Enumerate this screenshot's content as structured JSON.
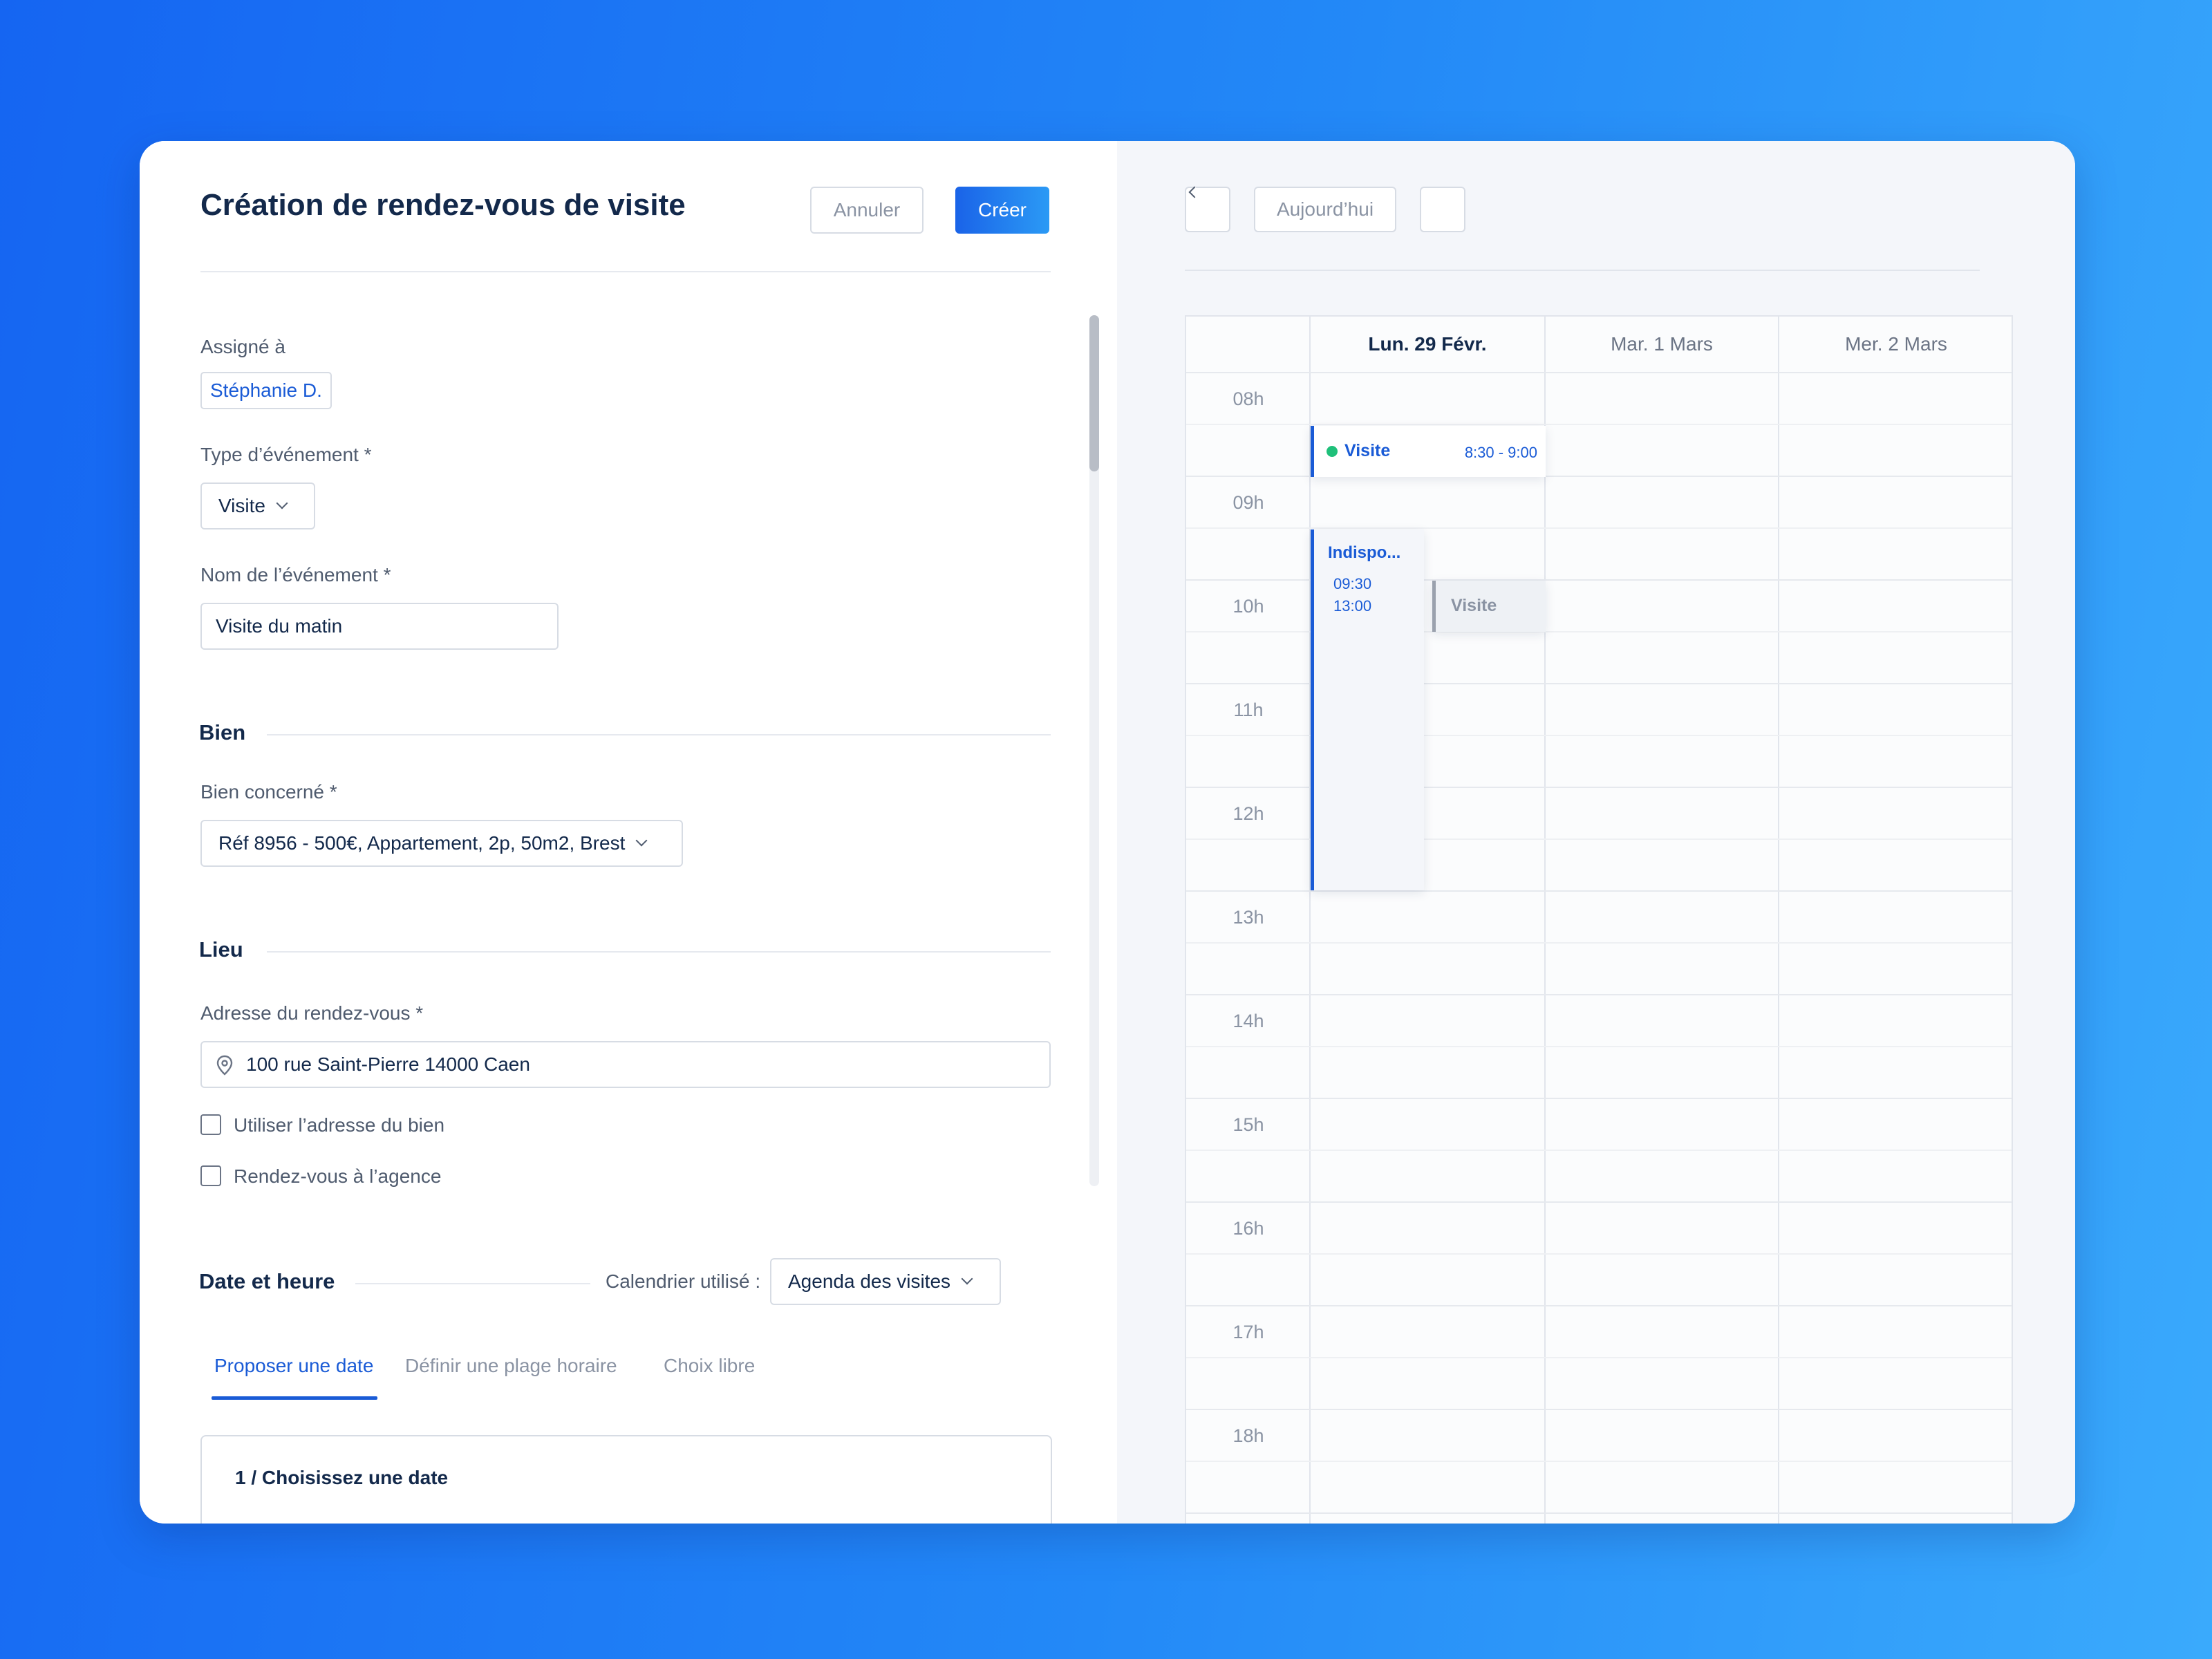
{
  "form": {
    "title": "Création de rendez-vous de visite",
    "cancel_label": "Annuler",
    "create_label": "Créer",
    "assigned_label": "Assigné à",
    "assigned_value": "Stéphanie D.",
    "event_type_label": "Type d’événement *",
    "event_type_value": "Visite",
    "event_name_label": "Nom de l’événement *",
    "event_name_value": "Visite du matin",
    "section_bien": "Bien",
    "property_label": "Bien concerné *",
    "property_value": "Réf 8956 - 500€,  Appartement,  2p, 50m2, Brest",
    "section_lieu": "Lieu",
    "address_label": "Adresse du rendez-vous *",
    "address_value": "100 rue Saint-Pierre 14000 Caen",
    "checkbox_use_property_address": "Utiliser l’adresse du bien",
    "checkbox_agency": "Rendez-vous à l’agence",
    "section_date": "Date et heure",
    "calendar_used_label": "Calendrier utilisé :",
    "calendar_used_value": "Agenda des visites",
    "tabs": [
      {
        "label": "Proposer une date",
        "active": true
      },
      {
        "label": "Définir une plage horaire",
        "active": false
      },
      {
        "label": "Choix libre",
        "active": false
      }
    ],
    "step_title": "1 / Choisissez une date"
  },
  "calendar": {
    "today_label": "Aujourd’hui",
    "days": [
      {
        "label": "Lun. 29 Févr.",
        "today": true
      },
      {
        "label": "Mar. 1 Mars",
        "today": false
      },
      {
        "label": "Mer. 2 Mars",
        "today": false
      }
    ],
    "hours": [
      "08h",
      "09h",
      "10h",
      "11h",
      "12h",
      "13h",
      "14h",
      "15h",
      "16h",
      "17h",
      "18h"
    ],
    "events": {
      "visite": {
        "title": "Visite",
        "time": "8:30 - 9:00"
      },
      "indispo": {
        "title": "Indispo...",
        "start": "09:30",
        "end": "13:00"
      },
      "visite2": {
        "title": "Visite"
      }
    }
  },
  "colors": {
    "accent": "#1a5bd6",
    "status_dot": "#1fc07a"
  },
  "icons": {
    "location": "map-pin-icon",
    "close": "close-icon",
    "prev": "chevron-left-icon",
    "next": "chevron-right-icon",
    "dropdown": "chevron-down-icon"
  }
}
